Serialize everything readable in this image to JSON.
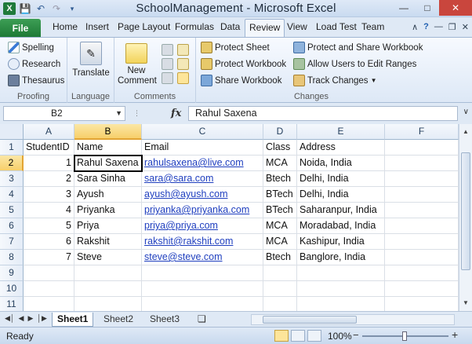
{
  "window": {
    "title": "SchoolManagement - Microsoft Excel",
    "logo": "X"
  },
  "tabs": {
    "file": "File",
    "items": [
      "Home",
      "Insert",
      "Page Layout",
      "Formulas",
      "Data",
      "Review",
      "View",
      "Load Test",
      "Team"
    ],
    "active": "Review"
  },
  "ribbon": {
    "proofing": {
      "label": "Proofing",
      "spelling": "Spelling",
      "research": "Research",
      "thesaurus": "Thesaurus"
    },
    "language": {
      "label": "Language",
      "translate": "Translate"
    },
    "comments": {
      "label": "Comments",
      "new_comment": "New Comment"
    },
    "changes": {
      "label": "Changes",
      "protect_sheet": "Protect Sheet",
      "protect_workbook": "Protect Workbook",
      "share_workbook": "Share Workbook",
      "protect_share": "Protect and Share Workbook",
      "allow_users": "Allow Users to Edit Ranges",
      "track_changes": "Track Changes"
    }
  },
  "formula_bar": {
    "name_box": "B2",
    "fx": "fx",
    "value": "Rahul Saxena"
  },
  "grid": {
    "columns": [
      "A",
      "B",
      "C",
      "D",
      "E",
      "F"
    ],
    "rows": [
      "1",
      "2",
      "3",
      "4",
      "5",
      "6",
      "7",
      "8",
      "9",
      "10",
      "11"
    ],
    "header": [
      "StudentID",
      "Name",
      "Email",
      "Class",
      "Address"
    ],
    "data": [
      [
        "1",
        "Rahul Saxena",
        "rahulsaxena@live.com",
        "MCA",
        "Noida, India"
      ],
      [
        "2",
        "Sara Sinha",
        "sara@sara.com",
        "Btech",
        "Delhi, India"
      ],
      [
        "3",
        "Ayush",
        "ayush@ayush.com",
        "BTech",
        "Delhi, India"
      ],
      [
        "4",
        "Priyanka",
        "priyanka@priyanka.com",
        "BTech",
        "Saharanpur, India"
      ],
      [
        "5",
        "Priya",
        "priya@priya.com",
        "MCA",
        "Moradabad, India"
      ],
      [
        "6",
        "Rakshit",
        "rakshit@rakshit.com",
        "MCA",
        "Kashipur, India"
      ],
      [
        "7",
        "Steve",
        "steve@steve.com",
        "Btech",
        "Banglore, India"
      ]
    ]
  },
  "sheets": {
    "items": [
      "Sheet1",
      "Sheet2",
      "Sheet3"
    ],
    "active": "Sheet1"
  },
  "status": {
    "ready": "Ready",
    "zoom": "100%"
  }
}
